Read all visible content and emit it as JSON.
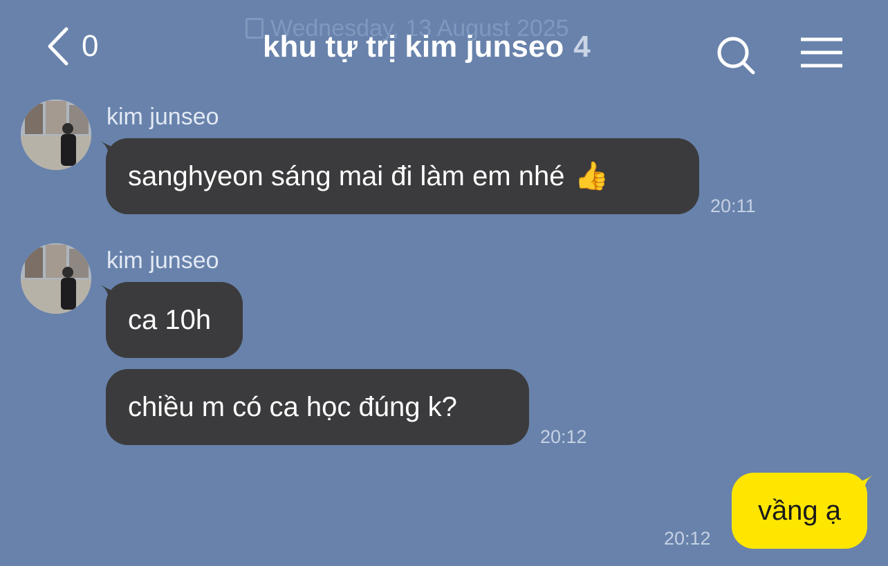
{
  "header": {
    "date_divider": "Wednesday, 13 August 2025",
    "back_count": "0",
    "title": "khu tự trị kim junseo",
    "member_count": "4",
    "search_icon": "search-icon",
    "menu_icon": "hamburger-menu-icon"
  },
  "messages": [
    {
      "sender": "kim junseo",
      "text": "sanghyeon sáng mai đi làm em nhé",
      "emoji": "👍",
      "time": "20:11"
    },
    {
      "sender": "kim junseo",
      "text": "ca 10h"
    },
    {
      "text": "chiều m có ca học đúng k?",
      "time": "20:12"
    }
  ],
  "my_messages": [
    {
      "text": "vầng ạ",
      "time": "20:12"
    }
  ],
  "colors": {
    "background": "#6882ab",
    "incoming_bubble": "#3b3b3d",
    "outgoing_bubble": "#ffe600"
  }
}
